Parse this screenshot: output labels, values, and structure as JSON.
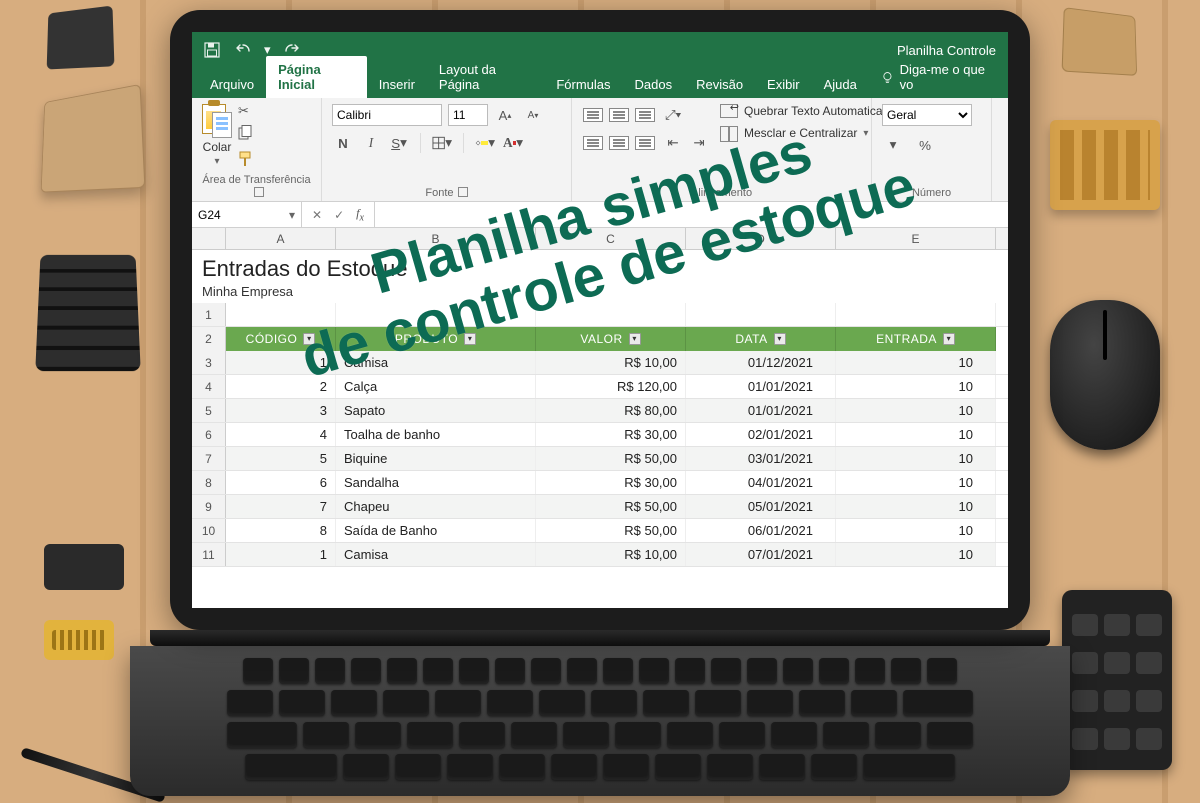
{
  "window_title": "Planilha Controle",
  "qat": {
    "save": "save-icon",
    "undo": "undo-icon",
    "redo": "redo-icon"
  },
  "tabs": {
    "items": [
      "Arquivo",
      "Página Inicial",
      "Inserir",
      "Layout da Página",
      "Fórmulas",
      "Dados",
      "Revisão",
      "Exibir",
      "Ajuda"
    ],
    "active_index": 1,
    "tell_me": "Diga-me o que vo"
  },
  "ribbon": {
    "clipboard": {
      "paste": "Colar",
      "title": "Área de Transferência"
    },
    "font": {
      "name": "Calibri",
      "size": "11",
      "bold": "N",
      "italic": "I",
      "underline": "S",
      "title": "Fonte",
      "inc": "A",
      "dec": "A"
    },
    "alignment": {
      "wrap": "Quebrar Texto Automaticamente",
      "merge": "Mesclar e Centralizar",
      "title": "Alinhamento"
    },
    "number": {
      "format": "Geral",
      "percent": "%",
      "title": "Número"
    }
  },
  "namebox": "G24",
  "formula": "",
  "sheet": {
    "title": "Entradas do Estoque",
    "company": "Minha Empresa",
    "columns": [
      "A",
      "B",
      "C",
      "D",
      "E"
    ],
    "headers": [
      "CÓDIGO",
      "PRODUTO",
      "VALOR",
      "DATA",
      "ENTRADA"
    ],
    "rows": [
      {
        "n": "3",
        "codigo": "1",
        "produto": "Camisa",
        "valor": "R$ 10,00",
        "data": "01/12/2021",
        "entrada": "10"
      },
      {
        "n": "4",
        "codigo": "2",
        "produto": "Calça",
        "valor": "R$ 120,00",
        "data": "01/01/2021",
        "entrada": "10"
      },
      {
        "n": "5",
        "codigo": "3",
        "produto": "Sapato",
        "valor": "R$ 80,00",
        "data": "01/01/2021",
        "entrada": "10"
      },
      {
        "n": "6",
        "codigo": "4",
        "produto": "Toalha de banho",
        "valor": "R$ 30,00",
        "data": "02/01/2021",
        "entrada": "10"
      },
      {
        "n": "7",
        "codigo": "5",
        "produto": "Biquine",
        "valor": "R$ 50,00",
        "data": "03/01/2021",
        "entrada": "10"
      },
      {
        "n": "8",
        "codigo": "6",
        "produto": "Sandalha",
        "valor": "R$ 30,00",
        "data": "04/01/2021",
        "entrada": "10"
      },
      {
        "n": "9",
        "codigo": "7",
        "produto": "Chapeu",
        "valor": "R$ 50,00",
        "data": "05/01/2021",
        "entrada": "10"
      },
      {
        "n": "10",
        "codigo": "8",
        "produto": "Saída de Banho",
        "valor": "R$ 50,00",
        "data": "06/01/2021",
        "entrada": "10"
      },
      {
        "n": "11",
        "codigo": "1",
        "produto": "Camisa",
        "valor": "R$ 10,00",
        "data": "07/01/2021",
        "entrada": "10"
      }
    ],
    "first_row_number": "1",
    "header_row_number": "2"
  },
  "watermark": {
    "line1": "Planilha simples",
    "line2": "de controle de estoque"
  },
  "colors": {
    "excel_green": "#217346",
    "table_header": "#6aa84f",
    "watermark": "#0d6b54"
  }
}
